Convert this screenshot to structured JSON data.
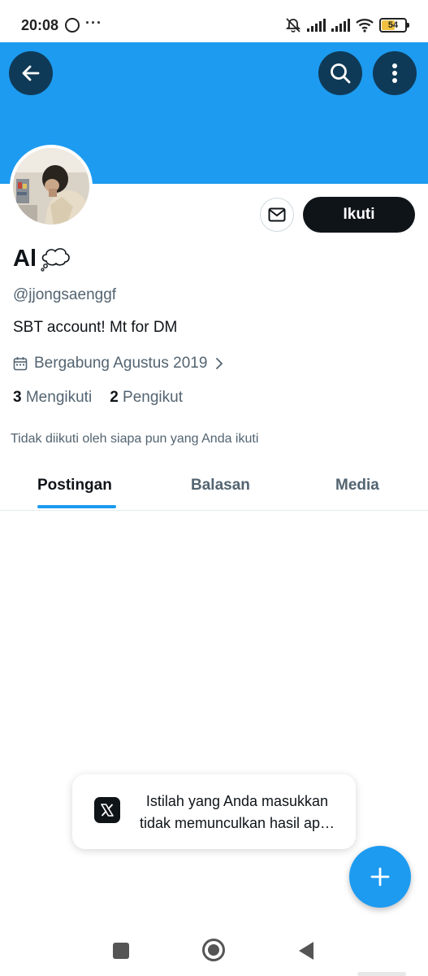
{
  "status_bar": {
    "time": "20:08",
    "overflow": "···",
    "battery": "54"
  },
  "header": {
    "back_icon": "arrow-left-icon",
    "search_icon": "search-icon",
    "more_icon": "more-vertical-icon",
    "banner_color": "#1d9bf0"
  },
  "profile": {
    "name": "Al",
    "name_emoji": "💭",
    "handle": "@jjongsaenggf",
    "bio": "SBT account! Mt for DM",
    "joined": "Bergabung Agustus 2019",
    "following_count": "3",
    "following_label": "Mengikuti",
    "followers_count": "2",
    "followers_label": "Pengikut",
    "not_followed_text": "Tidak diikuti oleh siapa pun yang Anda ikuti",
    "follow_button": "Ikuti"
  },
  "tabs": [
    {
      "label": "Postingan",
      "active": true
    },
    {
      "label": "Balasan",
      "active": false
    },
    {
      "label": "Media",
      "active": false
    }
  ],
  "toast": {
    "line1": "Istilah yang Anda masukkan",
    "line2": "tidak memunculkan hasil ap…"
  },
  "colors": {
    "accent": "#1d9bf0",
    "primary_text": "#0f1419",
    "secondary_text": "#536471"
  }
}
